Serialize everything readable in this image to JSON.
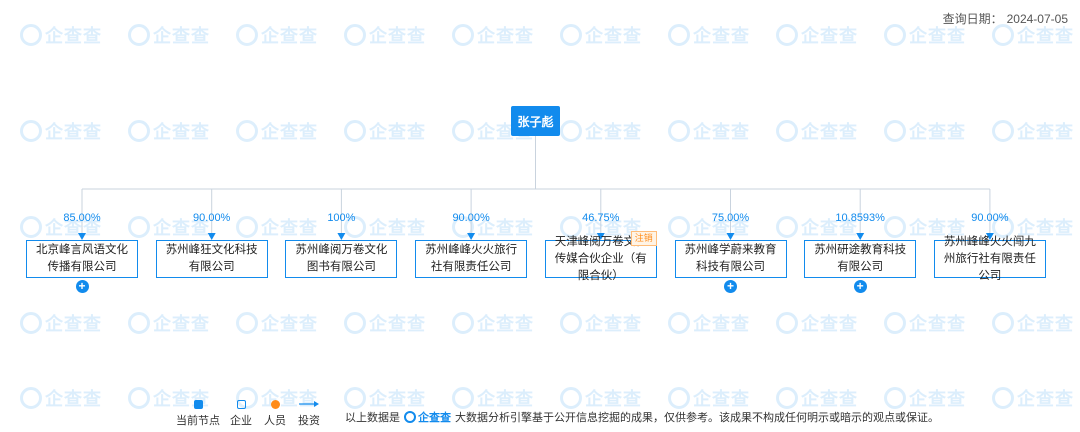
{
  "header": {
    "date_label": "查询日期：",
    "date_value": "2024-07-05"
  },
  "watermark": {
    "brand_text": "企查查"
  },
  "root": {
    "name": "张子彪"
  },
  "companies": [
    {
      "pct": "85.00%",
      "name": "北京峰言风语文化传播有限公司",
      "expandable": true,
      "badge": ""
    },
    {
      "pct": "90.00%",
      "name": "苏州峰狂文化科技有限公司",
      "expandable": false,
      "badge": ""
    },
    {
      "pct": "100%",
      "name": "苏州峰阅万卷文化图书有限公司",
      "expandable": false,
      "badge": ""
    },
    {
      "pct": "90.00%",
      "name": "苏州峰峰火火旅行社有限责任公司",
      "expandable": false,
      "badge": ""
    },
    {
      "pct": "46.75%",
      "name": "天津峰阅万卷文化传媒合伙企业（有限合伙）",
      "expandable": false,
      "badge": "注销"
    },
    {
      "pct": "75.00%",
      "name": "苏州峰学蔚来教育科技有限公司",
      "expandable": true,
      "badge": ""
    },
    {
      "pct": "10.8593%",
      "name": "苏州研途教育科技有限公司",
      "expandable": true,
      "badge": ""
    },
    {
      "pct": "90.00%",
      "name": "苏州峰峰火火闯九州旅行社有限责任公司",
      "expandable": false,
      "badge": ""
    }
  ],
  "legend": {
    "current": "当前节点",
    "company": "企业",
    "person": "人员",
    "invest": "投资"
  },
  "footer": {
    "prefix": "以上数据是",
    "brand": "企查查",
    "suffix": "大数据分析引擎基于公开信息挖掘的成果，仅供参考。该成果不构成任何明示或暗示的观点或保证。"
  },
  "colors": {
    "accent": "#128bed",
    "person": "#ff8c1a",
    "line": "#c9d3de"
  }
}
